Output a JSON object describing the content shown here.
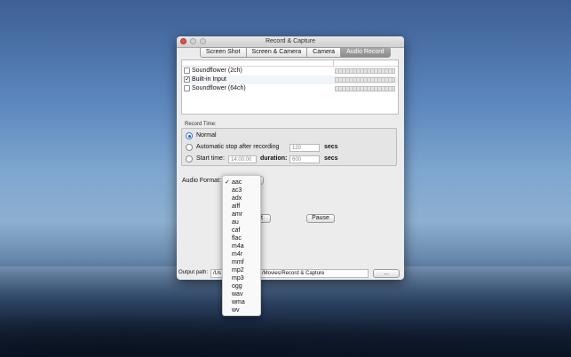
{
  "window": {
    "title": "Record & Capture",
    "tabs": [
      {
        "label": "Screen Shot",
        "active": false
      },
      {
        "label": "Screen & Camera",
        "active": false
      },
      {
        "label": "Camera",
        "active": false
      },
      {
        "label": "Audio Record",
        "active": true
      }
    ]
  },
  "inputs": [
    {
      "label": "Soundflower (2ch)",
      "checked": false,
      "mark": ""
    },
    {
      "label": "Built-in Input",
      "checked": true,
      "mark": "✓"
    },
    {
      "label": "Soundflower (64ch)",
      "checked": false,
      "mark": ""
    }
  ],
  "record_time": {
    "section_label": "Record Time:",
    "normal_label": "Normal",
    "auto_stop_label": "Automatic stop after recording",
    "auto_stop_value": "120",
    "secs_label": "secs",
    "start_time_label": "Start time:",
    "start_time_value": "14:00:00",
    "duration_label": "duration:",
    "duration_value": "600",
    "secs_label_2": "secs",
    "selected": "normal"
  },
  "audio_format": {
    "label": "Audio Format:",
    "selected": "aac",
    "options": [
      "aac",
      "ac3",
      "adx",
      "aiff",
      "amr",
      "au",
      "caf",
      "flac",
      "m4a",
      "m4r",
      "mmf",
      "mp2",
      "mp3",
      "ogg",
      "wav",
      "wma",
      "wv"
    ],
    "check_mark": "✓"
  },
  "buttons": {
    "start_label_visible": "t",
    "pause_label": "Pause",
    "browse_label": "..."
  },
  "output": {
    "label": "Output path:",
    "value_left": "/Us",
    "value_right": "/Movies/Record & Capture"
  }
}
